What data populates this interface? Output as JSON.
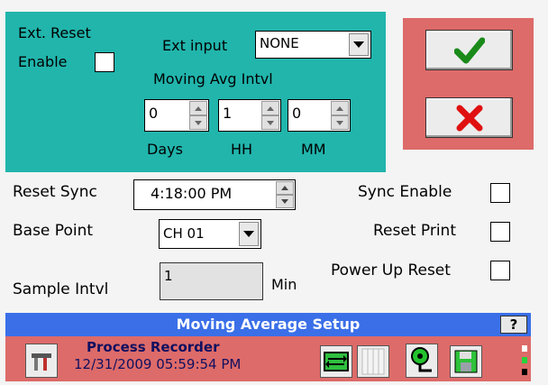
{
  "ext_reset": {
    "label_line1": "Ext. Reset",
    "enable_label": "Enable"
  },
  "ext_input": {
    "label": "Ext input",
    "value": "NONE"
  },
  "moving_avg": {
    "label": "Moving Avg Intvl",
    "days": "0",
    "hh": "1",
    "mm": "0",
    "days_label": "Days",
    "hh_label": "HH",
    "mm_label": "MM"
  },
  "reset_sync": {
    "label": "Reset Sync",
    "value": "4:18:00 PM"
  },
  "base_point": {
    "label": "Base Point",
    "value": "CH 01"
  },
  "sample_intvl": {
    "label": "Sample Intvl",
    "value": "1",
    "unit": "Min"
  },
  "sync_enable": {
    "label": "Sync Enable"
  },
  "reset_print": {
    "label": "Reset Print"
  },
  "power_up_reset": {
    "label": "Power Up Reset"
  },
  "title_bar": {
    "title": "Moving Average Setup",
    "help_label": "?"
  },
  "status": {
    "app_name": "Process Recorder",
    "datetime": "12/31/2009 05:59:54 PM"
  },
  "colors": {
    "teal": "#21b5ac",
    "red_panel": "#dd6b69",
    "title_blue": "#3a6fe8",
    "check_green": "#1a8a1a",
    "cross_red": "#e01010"
  }
}
